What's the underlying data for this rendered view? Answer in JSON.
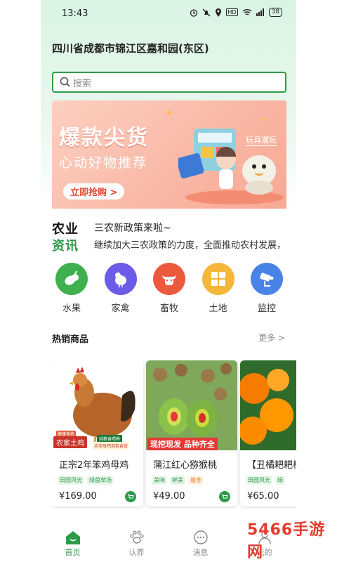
{
  "status": {
    "time": "13:43",
    "battery": "38"
  },
  "address": "四川省成都市锦江区嘉和园(东区)",
  "search": {
    "placeholder": "搜索"
  },
  "banner": {
    "title": "爆款尖货",
    "subtitle": "心动好物推荐",
    "button": "立即抢购 >",
    "tag": "玩具潮玩"
  },
  "news": {
    "logo_top": "农业",
    "logo_bottom": "资讯",
    "headline": "三农新政策来啦~",
    "description": "继续加大三农政策的力度，全面推动农村发展，"
  },
  "categories": [
    {
      "label": "水果",
      "color": "#3fb04f",
      "icon": "fruit-icon"
    },
    {
      "label": "家禽",
      "color": "#6c5ce7",
      "icon": "poultry-icon"
    },
    {
      "label": "畜牧",
      "color": "#ec5a3e",
      "icon": "livestock-icon"
    },
    {
      "label": "土地",
      "color": "#f4b73a",
      "icon": "land-icon"
    },
    {
      "label": "监控",
      "color": "#4a83e8",
      "icon": "monitor-icon"
    }
  ],
  "hot": {
    "title": "热销商品",
    "more": "更多 >"
  },
  "products": [
    {
      "name": "正宗2年笨鸡母鸡",
      "tags": [
        "田园风光",
        "绿茵草场"
      ],
      "price": "¥169.00",
      "badge_main": "农家土鸡",
      "badge_sub": "纯粮食喂养",
      "badge_top": "健康营养",
      "badge_extra": "买老母鸡到我食宜"
    },
    {
      "name": "蒲江红心猕猴桃",
      "tags": [
        "美味",
        "鲜美",
        "瘦身"
      ],
      "price": "¥49.00",
      "badge_main": "现挖现发 品种齐全"
    },
    {
      "name": "【丑橘耙耙柑",
      "tags": [
        "田园风光",
        "绿"
      ],
      "price": "¥65.00"
    }
  ],
  "tabs": [
    {
      "label": "首页",
      "icon": "home-icon",
      "active": true
    },
    {
      "label": "认养",
      "icon": "paw-icon",
      "active": false
    },
    {
      "label": "消息",
      "icon": "chat-icon",
      "active": false
    },
    {
      "label": "我的",
      "icon": "user-icon",
      "active": false
    }
  ],
  "watermark": "5466手游网",
  "colors": {
    "accent": "#2e9a49",
    "banner": "#f9b7a5"
  }
}
